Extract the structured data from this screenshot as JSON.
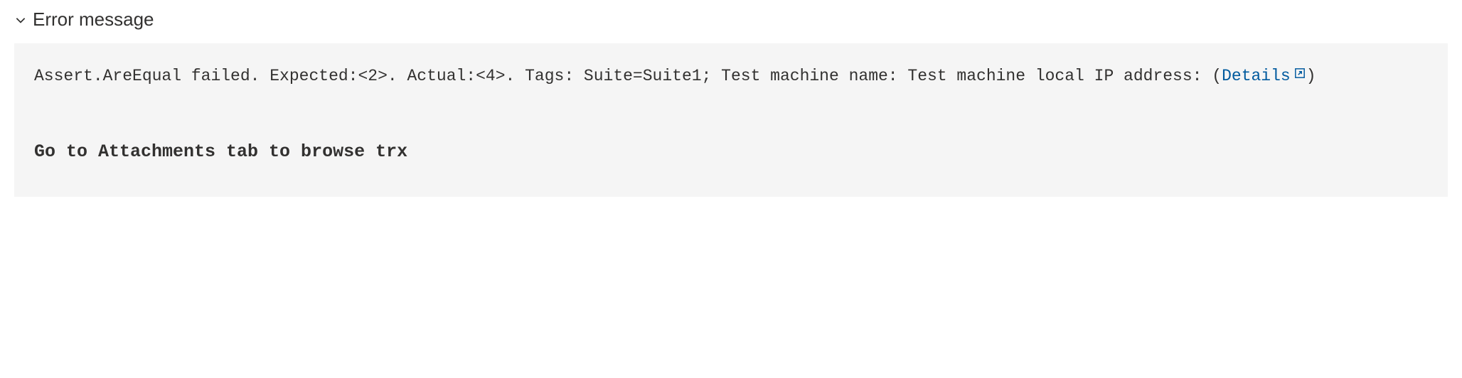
{
  "section": {
    "title": "Error message"
  },
  "error": {
    "message_prefix": "Assert.AreEqual failed. Expected:<2>. Actual:<4>. Tags: Suite=Suite1; Test machine name: Test machine local IP address: ",
    "details_label": "Details",
    "hint": "Go to Attachments tab to browse trx"
  },
  "colors": {
    "link": "#005a9e",
    "panel_bg": "#f5f5f5",
    "text": "#323130"
  }
}
